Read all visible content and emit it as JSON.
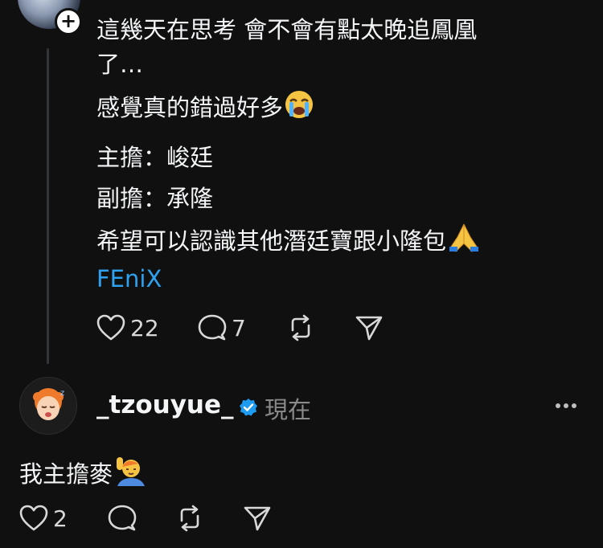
{
  "post": {
    "lines": [
      "這幾天在思考 會不會有點太晚追鳳凰",
      "了…",
      "感覺真的錯過好多",
      "主擔：峻廷",
      "副擔：承隆",
      "希望可以認識其他潛廷寶跟小隆包",
      "FEniX"
    ],
    "like_count": "22",
    "comment_count": "7"
  },
  "reply": {
    "username": "_tzouyue_",
    "timestamp": "現在",
    "text": "我主擔麥",
    "like_count": "2"
  },
  "icons": {
    "follow": "plus-icon",
    "verified": "verified-badge-icon",
    "more": "more-dots-icon",
    "like": "heart-icon",
    "comment": "comment-bubble-icon",
    "repost": "repost-icon",
    "share": "send-icon",
    "crying": "loudly-crying-face-emoji",
    "pray": "folded-hands-emoji",
    "raise": "person-raising-hand-emoji"
  },
  "colors": {
    "background": "#101010",
    "text": "#f3f5f7",
    "muted": "#8a8a8a",
    "link": "#2ea2f0",
    "verified": "#1d9bf0"
  }
}
